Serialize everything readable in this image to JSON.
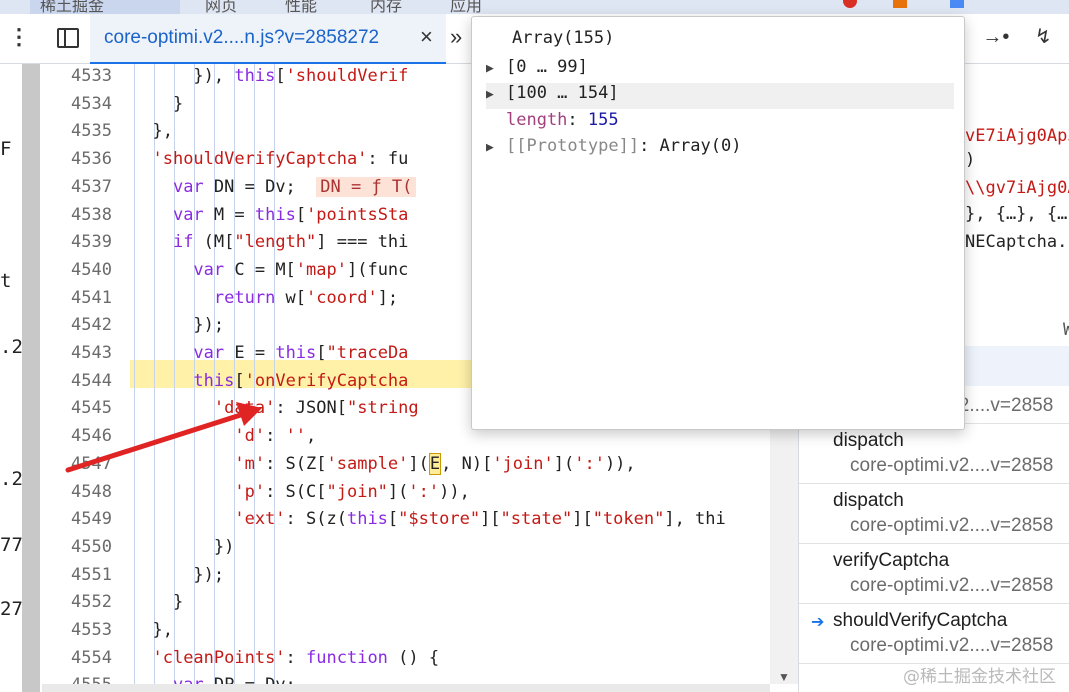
{
  "browser_tabs": [
    {
      "label": "稀土掘金",
      "active": true
    },
    {
      "label": "网页",
      "active": false
    },
    {
      "label": "性能",
      "active": false
    },
    {
      "label": "内存",
      "active": false
    },
    {
      "label": "应用",
      "active": false
    }
  ],
  "toolbar": {
    "file_tab": "core-optimi.v2....n.js?v=2858272",
    "close_label": "×",
    "more_tabs": "»",
    "step_icons": [
      "⇥",
      "→•",
      "↯"
    ]
  },
  "left_fragments": [
    {
      "text": "F"
    },
    {
      "text": "t"
    },
    {
      "text": ".2"
    },
    {
      "text": ".2"
    },
    {
      "text": "77"
    },
    {
      "text": "27"
    }
  ],
  "code_lines": [
    {
      "num": "4533",
      "html": "      }), <span class='k'>this</span>[<span class='s'>'shouldVerif</span>"
    },
    {
      "num": "4534",
      "html": "    }"
    },
    {
      "num": "4535",
      "html": "  },"
    },
    {
      "num": "4536",
      "html": "  <span class='s'>'shouldVerifyCaptcha'</span>: fu"
    },
    {
      "num": "4537",
      "html": "    <span class='k'>var</span> DN = Dv;  <span class='inl'>DN = ƒ T(</span>"
    },
    {
      "num": "4538",
      "html": "    <span class='k'>var</span> M = <span class='k'>this</span>[<span class='s'>'pointsSta</span>"
    },
    {
      "num": "4539",
      "html": "    <span class='k'>if</span> (M[<span class='s'>\"length\"</span>] === thi"
    },
    {
      "num": "4540",
      "html": "      <span class='k'>var</span> C = M[<span class='s'>'map'</span>](func"
    },
    {
      "num": "4541",
      "html": "        <span class='k'>return</span> w[<span class='s'>'coord'</span>];"
    },
    {
      "num": "4542",
      "html": "      });"
    },
    {
      "num": "4543",
      "html": "      <span class='k'>var</span> E = <span class='k'>this</span>[<span class='s'>\"traceDa</span>"
    },
    {
      "num": "4544",
      "html": "      <span class='k'>this</span>[<span class='s'>'onVerifyCaptcha</span>"
    },
    {
      "num": "4545",
      "html": "        <span class='s'>'data'</span>: JSON[<span class='s'>\"string</span>"
    },
    {
      "num": "4546",
      "html": "          <span class='s'>'d'</span>: <span class='s'>''</span>,"
    },
    {
      "num": "4547",
      "html": "          <span class='s'>'m'</span>: S(Z[<span class='s'>'sample'</span>](<span class='boxed'>E</span>, N)[<span class='s'>'join'</span>](<span class='s'>':'</span>)),"
    },
    {
      "num": "4548",
      "html": "          <span class='s'>'p'</span>: S(C[<span class='s'>\"join\"</span>](<span class='s'>':'</span>)),"
    },
    {
      "num": "4549",
      "html": "          <span class='s'>'ext'</span>: S(z(<span class='k'>this</span>[<span class='s'>\"$store\"</span>][<span class='s'>\"state\"</span>][<span class='s'>\"token\"</span>], thi"
    },
    {
      "num": "4550",
      "html": "        })"
    },
    {
      "num": "4551",
      "html": "      });"
    },
    {
      "num": "4552",
      "html": "    }"
    },
    {
      "num": "4553",
      "html": "  },"
    },
    {
      "num": "4554",
      "html": "  <span class='s'>'cleanPoints'</span>: <span class='k'>function</span> () {"
    },
    {
      "num": "4555",
      "html": "    <span class='k'>var</span> DP = Dv;"
    }
  ],
  "popup": {
    "title": "Array(155)",
    "rows": [
      {
        "tri": "▶",
        "text": "[0 … 99]",
        "kind": "range"
      },
      {
        "tri": "▶",
        "text": "[100 … 154]",
        "kind": "range"
      },
      {
        "tri": "",
        "key": "length",
        "value": "155",
        "kind": "length"
      },
      {
        "tri": "▶",
        "key": "[[Prototype]]",
        "value": "Array(0)",
        "kind": "proto"
      }
    ]
  },
  "scope_fragments": [
    {
      "text": "vE7iAjg0Ap3",
      "color": "#c41a16"
    },
    {
      "text": ")",
      "color": "#222"
    },
    {
      "text": "\\\\gv7iAjg0A",
      "color": "#c41a16"
    },
    {
      "text": "}, {…}, {…",
      "color": "#222"
    },
    {
      "text": "NECaptcha.r",
      "color": "#222"
    },
    {
      "text": "W",
      "color": "#555"
    }
  ],
  "call_stack": [
    {
      "fn": "",
      "loc": "core-optimi.v2....v=2858",
      "current": false
    },
    {
      "fn": "dispatch",
      "loc": "core-optimi.v2....v=2858",
      "current": false
    },
    {
      "fn": "dispatch",
      "loc": "core-optimi.v2....v=2858",
      "current": false
    },
    {
      "fn": "verifyCaptcha",
      "loc": "core-optimi.v2....v=2858",
      "current": false
    },
    {
      "fn": "shouldVerifyCaptcha",
      "loc": "core-optimi.v2....v=2858",
      "current": true
    }
  ],
  "watermark": "@稀土掘金技术社区"
}
